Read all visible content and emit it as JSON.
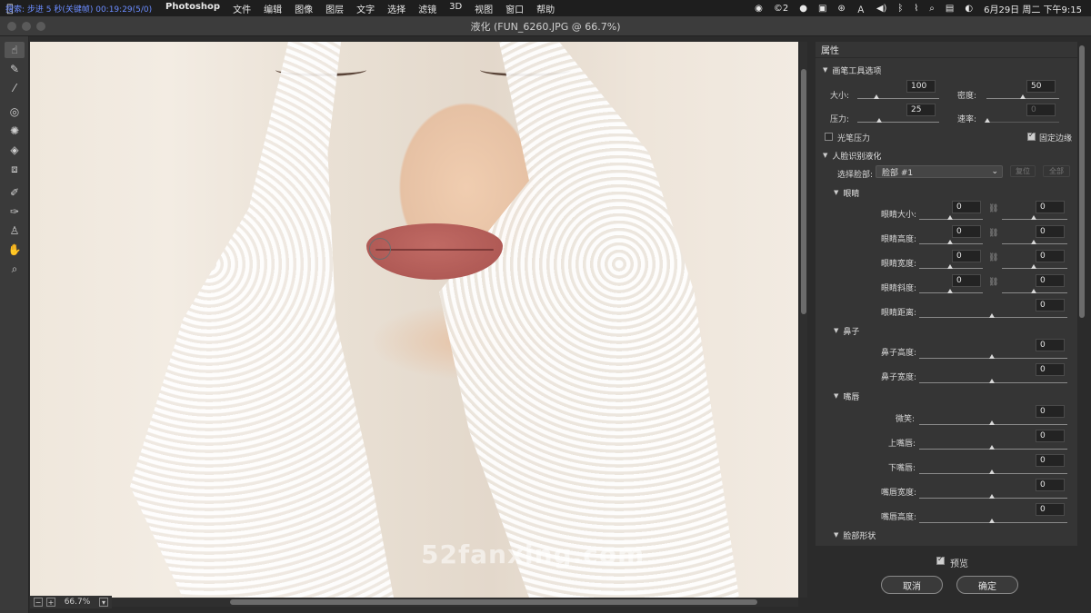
{
  "menubar": {
    "overlay": "搜索: 步进 5 秒(关键帧)  00:19:29(5/0)",
    "items": [
      "Photoshop",
      "文件",
      "编辑",
      "图像",
      "图层",
      "文字",
      "选择",
      "滤镜",
      "3D",
      "视图",
      "窗口",
      "帮助"
    ],
    "status_badge": "2",
    "date": "6月29日 周二 下午9:15"
  },
  "window": {
    "title": "液化 (FUN_6260.JPG @ 66.7%)"
  },
  "canvas": {
    "watermark": "52fanxing.com",
    "zoom": "66.7%"
  },
  "panel": {
    "title": "属性",
    "brush_section": "画笔工具选项",
    "size_label": "大小:",
    "size_value": "100",
    "density_label": "密度:",
    "density_value": "50",
    "pressure_label": "压力:",
    "pressure_value": "25",
    "rate_label": "速率:",
    "rate_value": "0",
    "stylus_label": "光笔压力",
    "pin_label": "固定边缘",
    "face_section": "人脸识别液化",
    "select_face_label": "选择脸部:",
    "select_face_value": "脸部 #1",
    "reset_label": "复位",
    "all_label": "全部",
    "eyes_section": "眼睛",
    "eyes": [
      {
        "label": "眼睛大小:",
        "l": "0",
        "r": "0"
      },
      {
        "label": "眼睛高度:",
        "l": "0",
        "r": "0"
      },
      {
        "label": "眼睛宽度:",
        "l": "0",
        "r": "0"
      },
      {
        "label": "眼睛斜度:",
        "l": "0",
        "r": "0"
      },
      {
        "label": "眼睛距离:",
        "v": "0"
      }
    ],
    "nose_section": "鼻子",
    "nose": [
      {
        "label": "鼻子高度:",
        "v": "0"
      },
      {
        "label": "鼻子宽度:",
        "v": "0"
      }
    ],
    "mouth_section": "嘴唇",
    "mouth": [
      {
        "label": "微笑:",
        "v": "0"
      },
      {
        "label": "上嘴唇:",
        "v": "0"
      },
      {
        "label": "下嘴唇:",
        "v": "0"
      },
      {
        "label": "嘴唇宽度:",
        "v": "0"
      },
      {
        "label": "嘴唇高度:",
        "v": "0"
      }
    ],
    "face_shape_section": "脸部形状"
  },
  "footer": {
    "preview_label": "预览",
    "cancel_label": "取消",
    "ok_label": "确定"
  }
}
